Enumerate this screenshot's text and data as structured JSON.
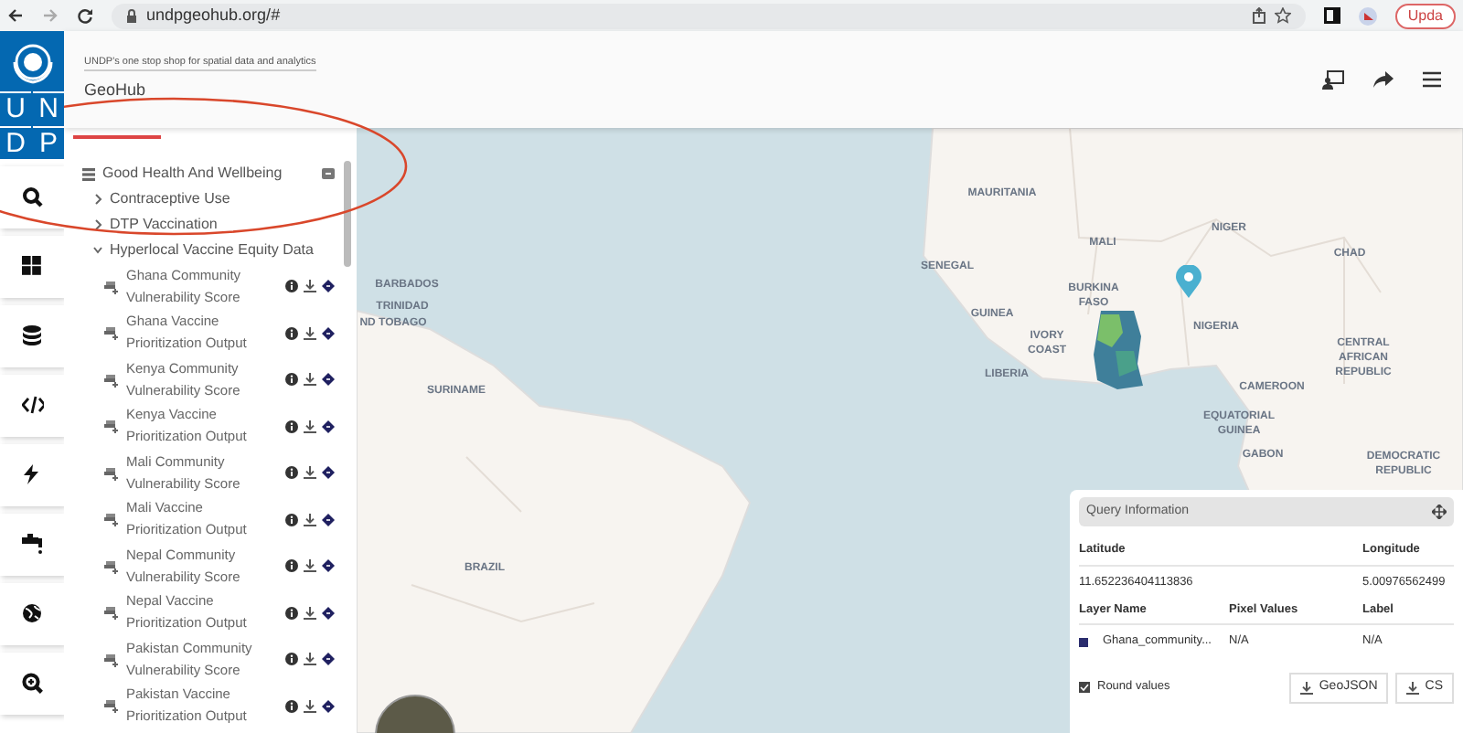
{
  "browser": {
    "url": "undpgeohub.org/#",
    "update_button": "Upda"
  },
  "logo": {
    "letters": [
      "U",
      "N",
      "D",
      "P"
    ]
  },
  "header": {
    "tagline": "UNDP's one stop shop for spatial data and analytics",
    "title": "GeoHub"
  },
  "layer_tree": [
    {
      "label": "Good Health And Wellbeing",
      "kind": "group",
      "expanded": true,
      "children": [
        {
          "label": "Contraceptive Use",
          "kind": "folder",
          "expanded": false
        },
        {
          "label": "DTP Vaccination",
          "kind": "folder",
          "expanded": false
        },
        {
          "label": "Hyperlocal Vaccine Equity Data",
          "kind": "folder",
          "expanded": true,
          "children": [
            {
              "label": "Ghana Community Vulnerability Score",
              "kind": "layer"
            },
            {
              "label": "Ghana Vaccine Prioritization Output",
              "kind": "layer"
            },
            {
              "label": "Kenya Community Vulnerability Score",
              "kind": "layer"
            },
            {
              "label": "Kenya Vaccine Prioritization Output",
              "kind": "layer"
            },
            {
              "label": "Mali Community Vulnerability Score",
              "kind": "layer"
            },
            {
              "label": "Mali Vaccine Prioritization Output",
              "kind": "layer"
            },
            {
              "label": "Nepal Community Vulnerability Score",
              "kind": "layer"
            },
            {
              "label": "Nepal Vaccine Prioritization Output",
              "kind": "layer"
            },
            {
              "label": "Pakistan Community Vulnerability Score",
              "kind": "layer"
            },
            {
              "label": "Pakistan Vaccine Prioritization Output",
              "kind": "layer"
            }
          ]
        }
      ]
    }
  ],
  "map": {
    "labels": [
      "MAURITANIA",
      "MALI",
      "NIGER",
      "CHAD",
      "SENEGAL",
      "BURKINA FASO",
      "GUINEA",
      "IVORY COAST",
      "NIGERIA",
      "LIBERIA",
      "CENTRAL AFRICAN REPUBLIC",
      "CAMEROON",
      "EQUATORIAL GUINEA",
      "GABON",
      "DEMOCRATIC REPUBLIC",
      "BARBADOS",
      "TRINIDAD",
      "ND TOBAGO",
      "SURINAME",
      "BRAZIL"
    ]
  },
  "query": {
    "title": "Query Information",
    "point_columns": [
      "Latitude",
      "Longitude"
    ],
    "point_values": [
      "11.652236404113836",
      "5.00976562499"
    ],
    "layer_columns": [
      "Layer Name",
      "Pixel Values",
      "Label"
    ],
    "layer_rows": [
      {
        "layer": "Ghana_community...",
        "pixel": "N/A",
        "label": "N/A"
      }
    ],
    "round_values": {
      "label": "Round values",
      "checked": true
    },
    "buttons": [
      "GeoJSON",
      "CS"
    ]
  }
}
